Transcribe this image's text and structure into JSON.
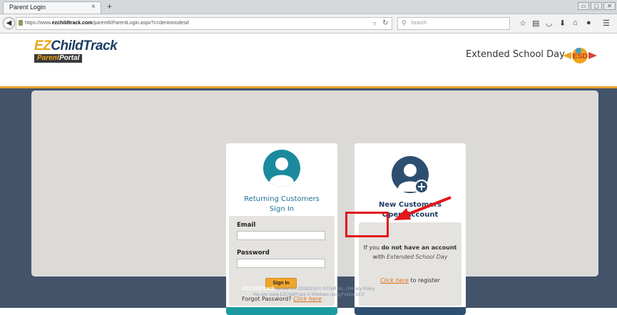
{
  "browser": {
    "tab_title": "Parent Login",
    "tab_close": "×",
    "new_tab": "+",
    "url_prefix": "https://www.",
    "url_domain": "ezchildtrack.com",
    "url_path": "/parent6/ParentLogin.aspx?c=dentonisdesd",
    "search_placeholder": "Search",
    "window_buttons": [
      "▭",
      "▢",
      "✕"
    ]
  },
  "header": {
    "logo_main_a": "EZ",
    "logo_main_b": "ChildTrack",
    "logo_sub_a": "Parent",
    "logo_sub_b": "Portal",
    "brand_text": "Extended School Day",
    "brand_badge": "ESD"
  },
  "returning": {
    "title_line1": "Returning Customers",
    "title_line2": "Sign In",
    "email_label": "Email",
    "email_value": "",
    "password_label": "Password",
    "password_value": "",
    "signin_label": "Sign In",
    "forgot_text": "Forgot Password?",
    "forgot_link": "Click here"
  },
  "newcust": {
    "title_line1": "New Customers",
    "title_line2": "Open Account",
    "info_pre": "If you",
    "info_bold": "do not have an account",
    "info_line2_pre": "with",
    "info_line2_em": "Extended School Day",
    "register_link": "Click here",
    "register_rest": "to register"
  },
  "footer": {
    "brand_a": "EZ",
    "brand_b": "ChildTrack",
    "line1": "Version 5.7.20180219 © GTSoft Inc. | Privacy Policy",
    "line2": "You are using EZChildTrack in Windows using Firefox 62.0"
  },
  "colors": {
    "accent_orange": "#f0a62b",
    "annotation_red": "#e2171b",
    "band_navy": "#43536a",
    "teal": "#1a9aa0"
  }
}
